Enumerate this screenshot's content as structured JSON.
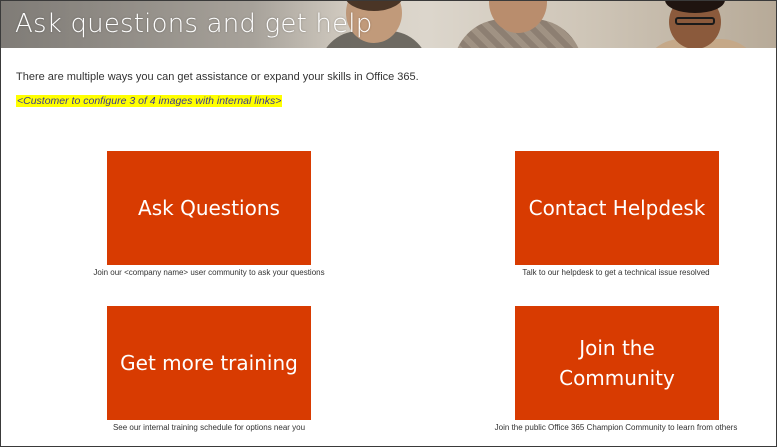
{
  "header": {
    "title": "Ask questions and get help"
  },
  "intro": {
    "text": "There are multiple ways you can get assistance or expand your skills in Office 365.",
    "note": "<Customer to configure 3 of 4 images with internal links>"
  },
  "colors": {
    "tile": "#d83b01",
    "highlight": "#ffff00"
  },
  "tiles": [
    {
      "label": "Ask Questions",
      "caption": "Join our <company name> user community to ask your questions"
    },
    {
      "label": "Contact Helpdesk",
      "caption": "Talk to our helpdesk to get a technical issue resolved"
    },
    {
      "label": "Get more training",
      "caption": "See our internal training schedule for options near you"
    },
    {
      "label": "Join the Community",
      "caption": "Join the public Office 365 Champion Community to learn from others"
    }
  ]
}
